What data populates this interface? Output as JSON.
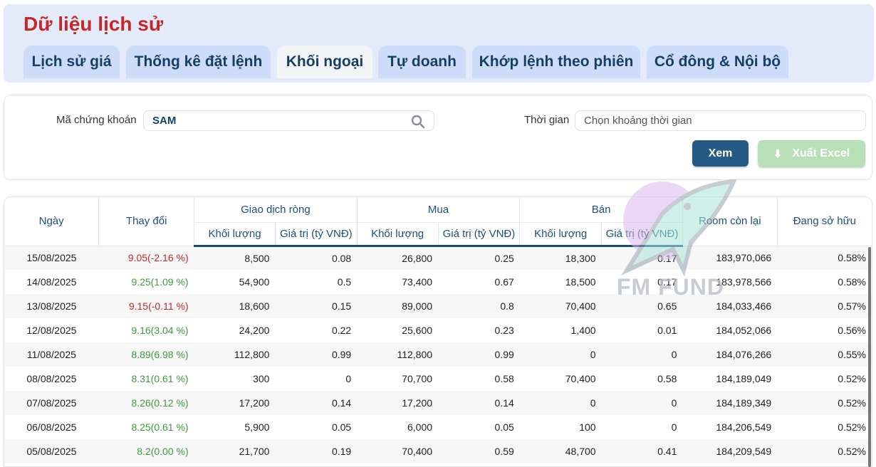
{
  "header": {
    "title": "Dữ liệu lịch sử"
  },
  "tabs": [
    {
      "label": "Lịch sử giá",
      "active": false
    },
    {
      "label": "Thống kê đặt lệnh",
      "active": false
    },
    {
      "label": "Khối ngoại",
      "active": true
    },
    {
      "label": "Tự doanh",
      "active": false
    },
    {
      "label": "Khớp lệnh theo phiên",
      "active": false
    },
    {
      "label": "Cổ đông & Nội bộ",
      "active": false
    }
  ],
  "filter": {
    "symbol_label": "Mã chứng khoán",
    "symbol_value": "SAM",
    "time_label": "Thời gian",
    "time_placeholder": "Chọn khoảng thời gian",
    "view_button": "Xem",
    "export_button": "Xuất Excel"
  },
  "watermark": "FM FUND",
  "table": {
    "headers": {
      "date": "Ngày",
      "change": "Thay đổi",
      "net": "Giao dịch ròng",
      "buy": "Mua",
      "sell": "Bán",
      "room": "Room còn lại",
      "own": "Đang sở hữu",
      "vol": "Khối lượng",
      "val": "Giá trị (tỷ VNĐ)"
    },
    "rows": [
      [
        "15/08/2025",
        "9.05(-2.16 %)",
        "down",
        "8,500",
        "0.08",
        "26,800",
        "0.25",
        "18,300",
        "0.17",
        "183,970,066",
        "0.58%"
      ],
      [
        "14/08/2025",
        "9.25(1.09 %)",
        "up",
        "54,900",
        "0.5",
        "73,400",
        "0.67",
        "18,500",
        "0.17",
        "183,978,566",
        "0.58%"
      ],
      [
        "13/08/2025",
        "9.15(-0.11 %)",
        "down",
        "18,600",
        "0.15",
        "89,000",
        "0.8",
        "70,400",
        "0.65",
        "184,033,466",
        "0.57%"
      ],
      [
        "12/08/2025",
        "9.16(3.04 %)",
        "up",
        "24,200",
        "0.22",
        "25,600",
        "0.23",
        "1,400",
        "0.01",
        "184,052,066",
        "0.56%"
      ],
      [
        "11/08/2025",
        "8.89(6.98 %)",
        "up",
        "112,800",
        "0.99",
        "112,800",
        "0.99",
        "0",
        "0",
        "184,076,266",
        "0.55%"
      ],
      [
        "08/08/2025",
        "8.31(0.61 %)",
        "up",
        "300",
        "0",
        "70,700",
        "0.58",
        "70,400",
        "0.58",
        "184,189,049",
        "0.52%"
      ],
      [
        "07/08/2025",
        "8.26(0.12 %)",
        "up",
        "17,200",
        "0.14",
        "17,200",
        "0.14",
        "0",
        "0",
        "184,189,349",
        "0.52%"
      ],
      [
        "06/08/2025",
        "8.25(0.61 %)",
        "up",
        "5,900",
        "0.05",
        "6,000",
        "0.05",
        "100",
        "0",
        "184,206,549",
        "0.52%"
      ],
      [
        "05/08/2025",
        "8.2(0.00 %)",
        "up",
        "21,700",
        "0.19",
        "70,400",
        "0.59",
        "48,700",
        "0.41",
        "184,209,549",
        "0.52%"
      ]
    ]
  }
}
